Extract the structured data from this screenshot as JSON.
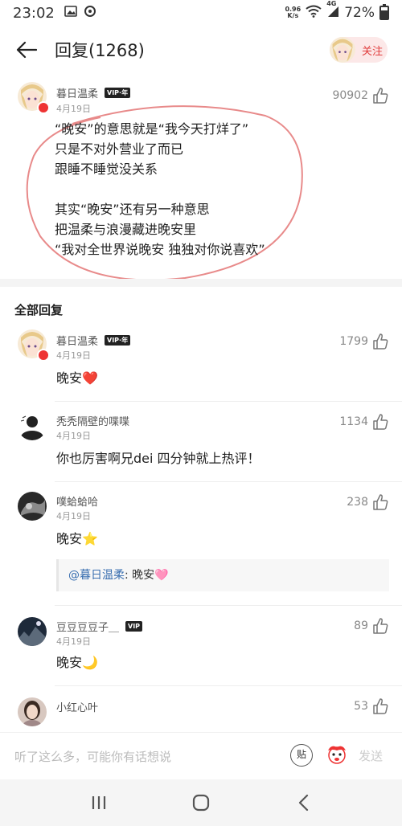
{
  "status_bar": {
    "time": "23:02",
    "net_speed_value": "0.96",
    "net_speed_unit": "K/s",
    "signal_label": "4G",
    "battery": "72%",
    "battery_level": 0.72
  },
  "header": {
    "title": "回复(1268)",
    "follow_label": "关注"
  },
  "top_comment": {
    "user": "暮日温柔",
    "vip": "VIP·年",
    "date": "4月19日",
    "likes": "90902",
    "lines": [
      "“晚安”的意思就是“我今天打烊了”",
      "只是不对外营业了而已",
      "跟睡不睡觉没关系",
      "",
      "其实“晚安”还有另一种意思",
      "把温柔与浪漫藏进晚安里",
      "“我对全世界说晚安 独独对你说喜欢”"
    ]
  },
  "section_title": "全部回复",
  "replies": [
    {
      "user": "暮日温柔",
      "vip": "VIP·年",
      "date": "4月19日",
      "likes": "1799",
      "text": "晚安❤️"
    },
    {
      "user": "秃秃隔壁的喋喋",
      "date": "4月19日",
      "likes": "1134",
      "text": "你也厉害啊兄dei 四分钟就上热评！"
    },
    {
      "user": "噗蛤蛤哈",
      "date": "4月19日",
      "likes": "238",
      "text": "晚安⭐",
      "quote_at": "@暮日温柔",
      "quote_text": ": 晚安🩷"
    },
    {
      "user": "豆豆豆豆子＿",
      "vip": "VIP",
      "date": "4月19日",
      "likes": "89",
      "text": "晚安🌙"
    },
    {
      "user": "小红心叶",
      "date": "",
      "likes": "53",
      "text": ""
    }
  ],
  "input_bar": {
    "placeholder": "听了这么多，可能你有话想说",
    "sticker_label": "贴",
    "send_label": "发送"
  },
  "colors": {
    "accent": "#e03c3c",
    "link": "#3a6fb0",
    "oval": "#e88a8a"
  }
}
